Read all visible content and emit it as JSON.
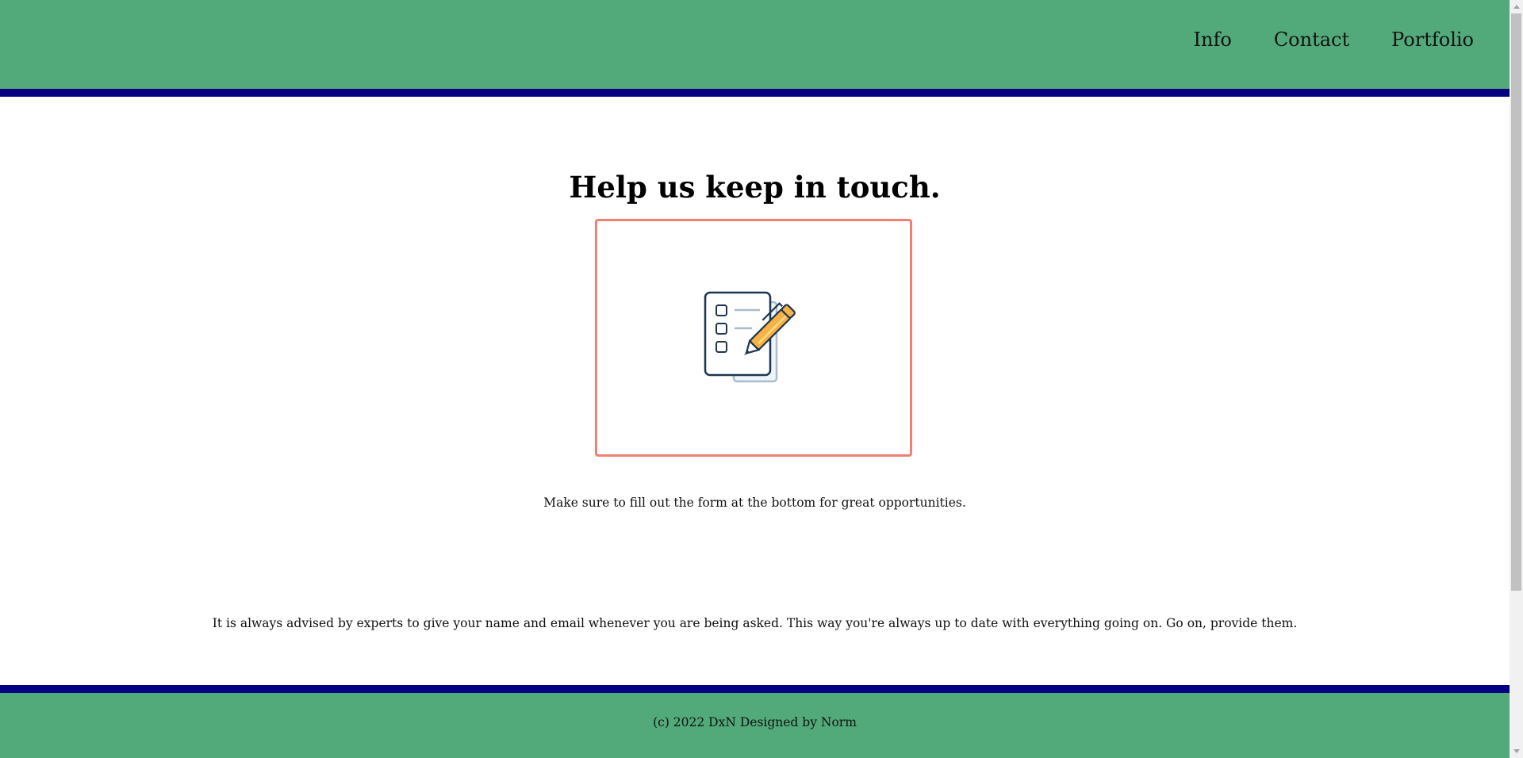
{
  "header": {
    "nav": [
      {
        "label": "Info"
      },
      {
        "label": "Contact"
      },
      {
        "label": "Portfolio"
      }
    ],
    "background_color": "#52aa7a",
    "border_color": "#000080"
  },
  "main": {
    "title": "Help us keep in touch.",
    "image_icon": "checklist-with-pen-icon",
    "image_border_color": "#f08070",
    "lead_text": "Make sure to fill out the form at the bottom for great opportunities.",
    "advice_text": "It is always advised by experts to give your name and email whenever you are being asked. This way you're always up to date with everything going on. Go on, provide them."
  },
  "footer": {
    "text": "(c) 2022 DxN Designed by Norm"
  }
}
